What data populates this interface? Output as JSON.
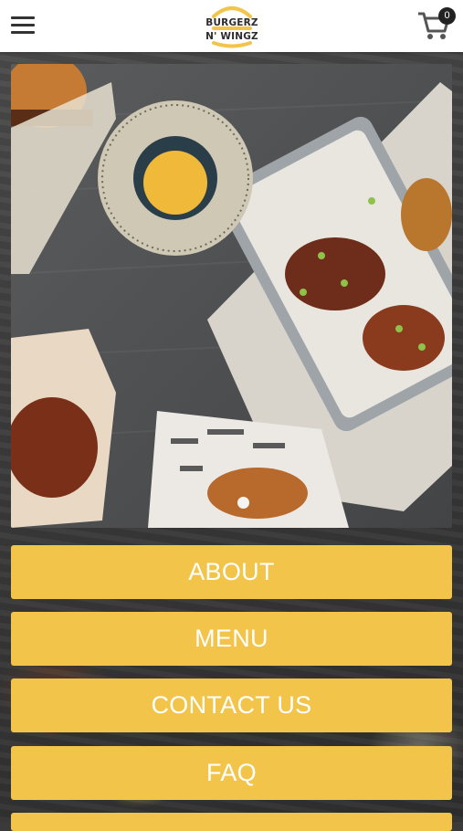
{
  "header": {
    "logo_line1": "BURGERZ",
    "logo_line2": "N' WINGZ",
    "cart_count": "0",
    "brand_color": "#f2c44a"
  },
  "hero": {
    "slide_index": 1,
    "slide_count": 1
  },
  "nav": {
    "about": "ABOUT",
    "menu": "MENU",
    "contact": "CONTACT US",
    "faq": "FAQ"
  },
  "icons": [
    "hamburger-menu-icon",
    "shopping-cart-icon"
  ]
}
